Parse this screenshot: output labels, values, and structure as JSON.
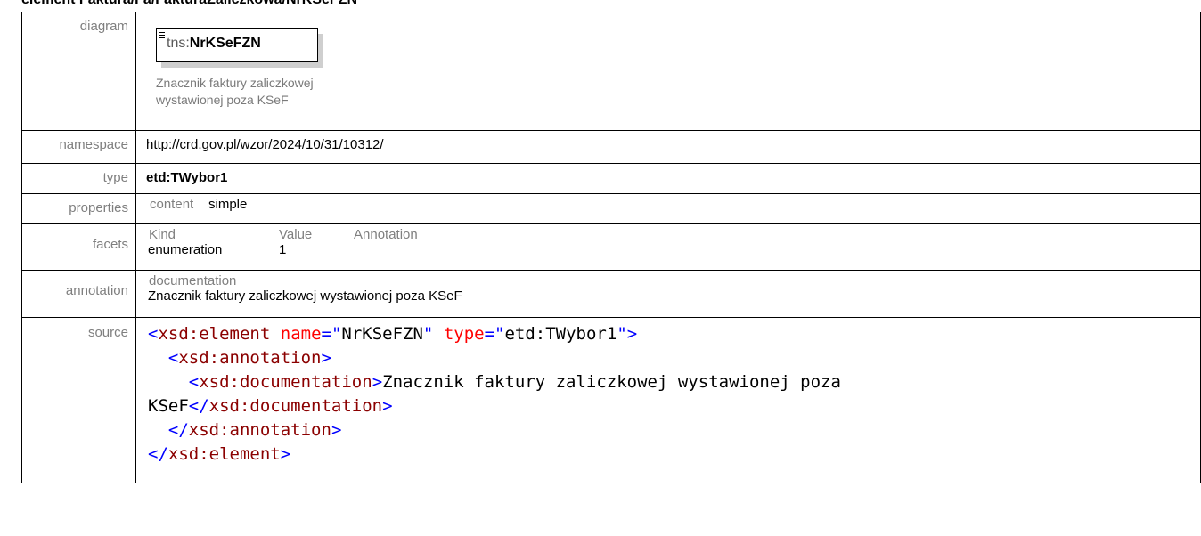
{
  "heading": "element Faktura/Fa/FakturaZaliczkowa/NrKSeFZN",
  "rows": {
    "diagram_label": "diagram",
    "namespace_label": "namespace",
    "type_label": "type",
    "properties_label": "properties",
    "facets_label": "facets",
    "annotation_label": "annotation",
    "source_label": "source"
  },
  "diagram": {
    "prefix": "tns:",
    "element": "NrKSeFZN",
    "doc_line1": "Znacznik faktury zaliczkowej",
    "doc_line2": "wystawionej poza KSeF"
  },
  "namespace": "http://crd.gov.pl/wzor/2024/10/31/10312/",
  "type": "etd:TWybor1",
  "properties": {
    "key": "content",
    "value": "simple"
  },
  "facets": {
    "headers": [
      "Kind",
      "Value",
      "Annotation"
    ],
    "row": {
      "kind": "enumeration",
      "value": "1",
      "annotation": ""
    }
  },
  "annotation": {
    "header": "documentation",
    "text": "Znacznik faktury zaliczkowej wystawionej poza KSeF"
  },
  "source": {
    "l1_open": "<",
    "l1_tag": "xsd:element",
    "l1_a1": "name",
    "l1_eq1": "=\"",
    "l1_v1": "NrKSeFZN",
    "l1_q1": "\"",
    "l1_a2": "type",
    "l1_eq2": "=\"",
    "l1_v2": "etd:TWybor1",
    "l1_close": "\">",
    "l2_open": "<",
    "l2_tag": "xsd:annotation",
    "l2_close": ">",
    "l3_open": "<",
    "l3_tag": "xsd:documentation",
    "l3_close": ">",
    "l3_text": "Znacznik faktury zaliczkowej wystawionej poza",
    "l4_text": "KSeF",
    "l4_open": "</",
    "l4_tag": "xsd:documentation",
    "l4_close": ">",
    "l5_open": "</",
    "l5_tag": "xsd:annotation",
    "l5_close": ">",
    "l6_open": "</",
    "l6_tag": "xsd:element",
    "l6_close": ">"
  }
}
